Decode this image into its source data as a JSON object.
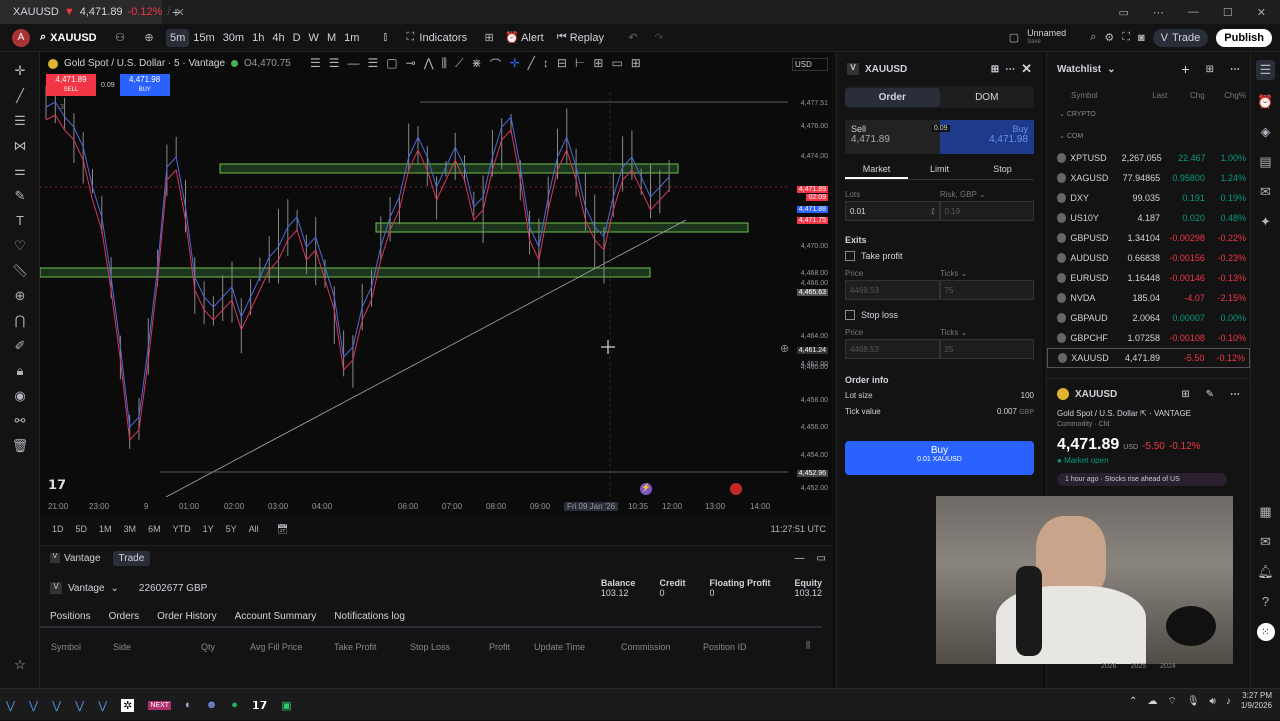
{
  "titlebar": {
    "tab_title": "XAUUSD",
    "tab_price": "4,471.89",
    "tab_change": "-0.12%",
    "tab_extra": "/"
  },
  "toolbar": {
    "symbol": "XAUUSD",
    "timeframes": [
      "5m",
      "15m",
      "30m",
      "1h",
      "4h",
      "D",
      "W",
      "M",
      "1m"
    ],
    "indicators": "Indicators",
    "alert": "Alert",
    "replay": "Replay",
    "layout_name": "Unnamed",
    "layout_sub": "Save",
    "trade": "Trade",
    "publish": "Publish"
  },
  "chart": {
    "title": "Gold Spot / U.S. Dollar · 5 · Vantage",
    "ohlc": "O4,470.75",
    "sell_price": "4,471.89",
    "sell_label": "SELL",
    "spread": "0.09",
    "buy_price": "4,471.98",
    "buy_label": "BUY",
    "currency": "USD",
    "marker_3": "3",
    "price_labels": [
      "4,477.51",
      "4,476.00",
      "4,474.00",
      "4,471.89",
      "02:09",
      "4,471.88",
      "4,471.75",
      "4,470.00",
      "4,468.00",
      "4,466.00",
      "4,465.63",
      "4,464.00",
      "4,462.00",
      "4,461.24",
      "4,460.00",
      "4,458.00",
      "4,456.00",
      "4,454.00",
      "4,452.96",
      "4,452.00"
    ],
    "time_labels": [
      "21:00",
      "23:00",
      "9",
      "01:00",
      "02:00",
      "03:00",
      "04:00",
      "06:00",
      "07:00",
      "08:00",
      "09:00",
      "Fri 09 Jan '26",
      "10:35",
      "12:00",
      "13:00",
      "14:00"
    ],
    "ranges": [
      "1D",
      "5D",
      "1M",
      "3M",
      "6M",
      "YTD",
      "1Y",
      "5Y",
      "All"
    ],
    "clock": "11:27:51 UTC"
  },
  "bottom": {
    "tabs": [
      "Vantage",
      "Trade"
    ],
    "account": "Vantage",
    "account_id": "22602677 GBP",
    "stats": [
      {
        "label": "Balance",
        "value": "103.12"
      },
      {
        "label": "Credit",
        "value": "0"
      },
      {
        "label": "Floating Profit",
        "value": "0"
      },
      {
        "label": "Equity",
        "value": "103.12"
      }
    ],
    "subtabs": [
      "Positions",
      "Orders",
      "Order History",
      "Account Summary",
      "Notifications log"
    ],
    "columns": [
      "Symbol",
      "Side",
      "Qty",
      "Avg Fill Price",
      "Take Profit",
      "Stop Loss",
      "Profit",
      "Update Time",
      "Commission",
      "Position ID"
    ]
  },
  "order": {
    "symbol": "XAUUSD",
    "tab_order": "Order",
    "tab_dom": "DOM",
    "sell_label": "Sell",
    "sell_price": "4,471.89",
    "spread": "0.09",
    "buy_label": "Buy",
    "buy_price": "4,471.98",
    "types": [
      "Market",
      "Limit",
      "Stop"
    ],
    "lots_label": "Lots",
    "lots_value": "0.01",
    "risk_label": "Risk, GBP",
    "risk_value": "0.19",
    "exits": "Exits",
    "take_profit": "Take profit",
    "stop_loss": "Stop loss",
    "price_label": "Price",
    "ticks_label": "Ticks",
    "tp_price": "4469.53",
    "tp_ticks": "75",
    "sl_price": "4468.53",
    "sl_ticks": "25",
    "info_title": "Order info",
    "lot_size_label": "Lot size",
    "lot_size": "100",
    "tick_value_label": "Tick value",
    "tick_value": "0.007",
    "tick_value_unit": "GBP",
    "buy_button": "Buy",
    "buy_sub": "0.01 XAUUSD"
  },
  "watchlist": {
    "title": "Watchlist",
    "cols": [
      "Symbol",
      "Last",
      "Chg",
      "Chg%"
    ],
    "section1": "CRYPTO",
    "section2": "COM",
    "rows": [
      {
        "sym": "XPTUSD",
        "last": "2,267.055",
        "chg": "22.467",
        "pct": "1.00%",
        "dir": "up"
      },
      {
        "sym": "XAGUSD",
        "last": "77.94865",
        "chg": "0.95800",
        "pct": "1.24%",
        "dir": "up"
      },
      {
        "sym": "DXY",
        "last": "99.035",
        "chg": "0.191",
        "pct": "0.19%",
        "dir": "up"
      },
      {
        "sym": "US10Y",
        "last": "4.187",
        "chg": "0.020",
        "pct": "0.48%",
        "dir": "up"
      },
      {
        "sym": "GBPUSD",
        "last": "1.34104",
        "chg": "-0.00298",
        "pct": "-0.22%",
        "dir": "down"
      },
      {
        "sym": "AUDUSD",
        "last": "0.66838",
        "chg": "-0.00156",
        "pct": "-0.23%",
        "dir": "down"
      },
      {
        "sym": "EURUSD",
        "last": "1.16448",
        "chg": "-0.00146",
        "pct": "-0.13%",
        "dir": "down"
      },
      {
        "sym": "NVDA",
        "last": "185.04",
        "chg": "-4.07",
        "pct": "-2.15%",
        "dir": "down"
      },
      {
        "sym": "GBPAUD",
        "last": "2.0064",
        "chg": "0.00007",
        "pct": "0.00%",
        "dir": "up"
      },
      {
        "sym": "GBPCHF",
        "last": "1.07258",
        "chg": "-0.00108",
        "pct": "-0.10%",
        "dir": "down"
      },
      {
        "sym": "XAUUSD",
        "last": "4,471.89",
        "chg": "-5.50",
        "pct": "-0.12%",
        "dir": "down"
      }
    ],
    "detail_symbol": "XAUUSD",
    "detail_name": "Gold Spot / U.S. Dollar",
    "detail_exchange": "VANTAGE",
    "detail_type": "Commodity · Cfd",
    "detail_price": "4,471.89",
    "detail_currency": "USD",
    "detail_chg": "-5.50",
    "detail_pct": "-0.12%",
    "market_status": "Market open",
    "news": "1 hour ago · Stocks rise ahead of US",
    "years": [
      "2026",
      "2025",
      "2024"
    ]
  },
  "taskbar": {
    "time": "3:27 PM",
    "date": "1/9/2026"
  }
}
